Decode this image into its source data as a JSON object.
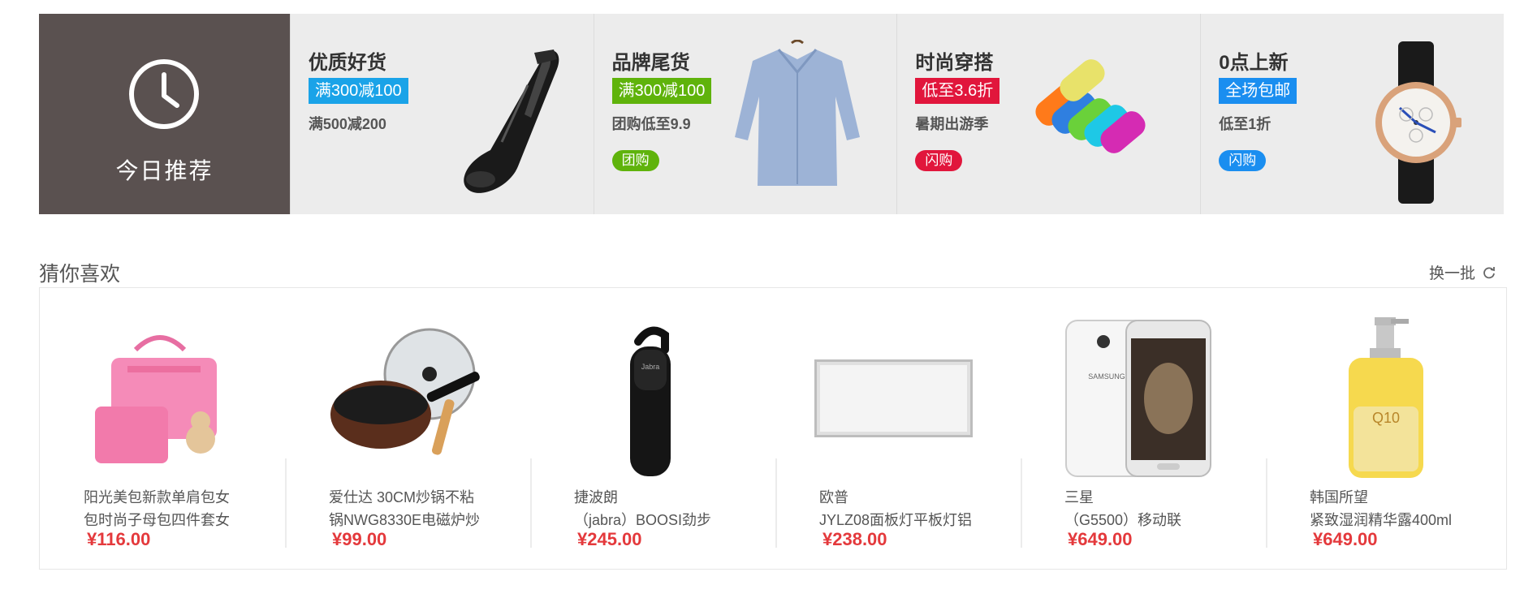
{
  "today": {
    "label": "今日推荐",
    "icon": "clock-icon"
  },
  "deals": [
    {
      "title": "优质好货",
      "tag": "满300减100",
      "tag_color": "#1aa3e8",
      "sub": "满500减200",
      "pill": "",
      "pill_color": "",
      "icon": "handheld-vacuum-image"
    },
    {
      "title": "品牌尾货",
      "tag": "满300减100",
      "tag_color": "#5fb30b",
      "sub": "团购低至9.9",
      "pill": "团购",
      "pill_color": "#5fb30b",
      "icon": "blue-shirt-image"
    },
    {
      "title": "时尚穿搭",
      "tag": "低至3.6折",
      "tag_color": "#e1163c",
      "sub": "暑期出游季",
      "pill": "闪购",
      "pill_color": "#e1163c",
      "icon": "colorful-towels-image"
    },
    {
      "title": "0点上新",
      "tag": "全场包邮",
      "tag_color": "#1a8ef0",
      "sub": "低至1折",
      "pill": "闪购",
      "pill_color": "#1a8ef0",
      "icon": "wrist-watch-image"
    }
  ],
  "guess": {
    "title": "猜你喜欢",
    "refresh_label": "换一批",
    "refresh_icon": "refresh-icon",
    "items": [
      {
        "name": "阳光美包新款单肩包女\n包时尚子母包四件套女",
        "price": "¥116.00",
        "icon": "pink-handbag-image"
      },
      {
        "name": "爱仕达 30CM炒锅不粘\n锅NWG8330E电磁炉炒",
        "price": "¥99.00",
        "icon": "wok-pan-image"
      },
      {
        "name": "捷波朗\n（jabra）BOOSI劲步",
        "price": "¥245.00",
        "icon": "bluetooth-headset-image"
      },
      {
        "name": "欧普\nJYLZ08面板灯平板灯铝",
        "price": "¥238.00",
        "icon": "panel-light-image"
      },
      {
        "name": "三星\n（G5500）移动联",
        "price": "¥649.00",
        "icon": "smartphone-image"
      },
      {
        "name": "韩国所望\n紧致湿润精华露400ml",
        "price": "¥649.00",
        "icon": "lotion-bottle-image"
      }
    ]
  }
}
